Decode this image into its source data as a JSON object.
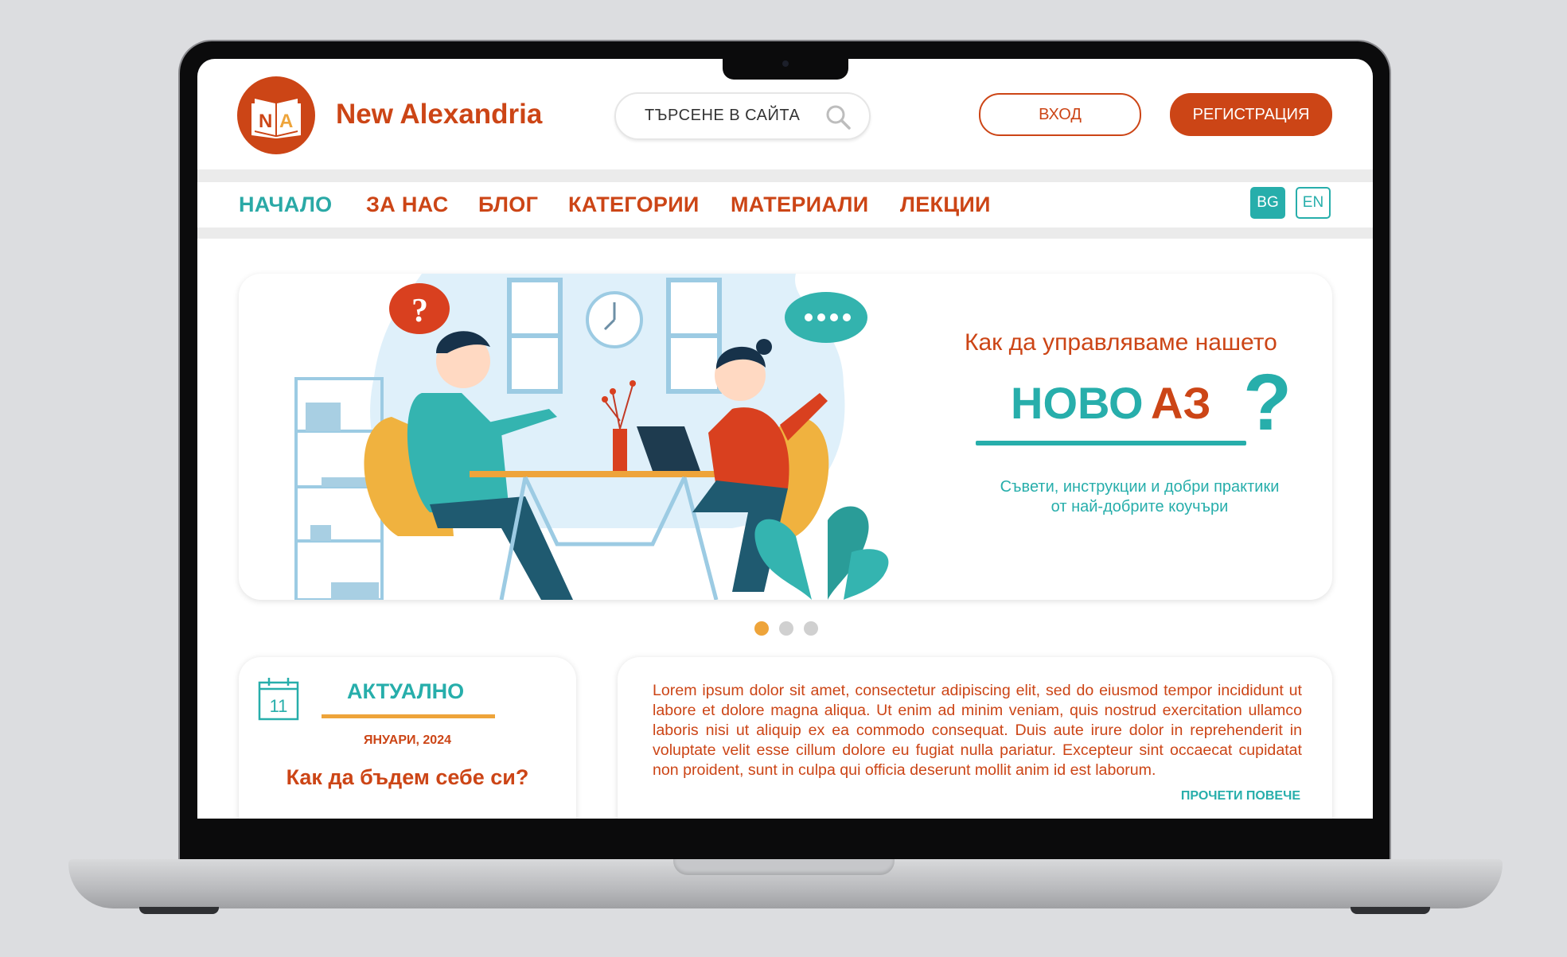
{
  "brand": {
    "logo_letters": "N|A",
    "name": "New Alexandria"
  },
  "header": {
    "search_placeholder": "ТЪРСЕНЕ В САЙТА",
    "login_label": "ВХОД",
    "register_label": "РЕГИСТРАЦИЯ"
  },
  "nav": {
    "items": [
      {
        "label": "НАЧАЛО",
        "active": true
      },
      {
        "label": "ЗА НАС"
      },
      {
        "label": "БЛОГ"
      },
      {
        "label": "КАТЕГОРИИ"
      },
      {
        "label": "МАТЕРИАЛИ"
      },
      {
        "label": "ЛЕКЦИИ"
      }
    ],
    "languages": [
      {
        "code": "BG",
        "active": true
      },
      {
        "code": "EN"
      }
    ]
  },
  "hero": {
    "subtitle": "Как да управляваме нашето",
    "title_part1": "НОВО",
    "title_part2": "АЗ",
    "title_mark": "?",
    "description_line1": "Съвети, инструкции и добри практики",
    "description_line2": "от най-добрите коучъри",
    "slides_total": 3,
    "active_slide": 1
  },
  "news_card": {
    "calendar_day": "11",
    "title": "АКТУАЛНО",
    "date": "ЯНУАРИ, 2024",
    "headline": "Как да бъдем себе си?"
  },
  "text_card": {
    "body": "Lorem ipsum dolor sit amet, consectetur adipiscing elit, sed do eiusmod tempor incididunt ut labore et dolore magna aliqua. Ut enim ad minim veniam, quis nostrud exercitation ullamco laboris nisi ut aliquip ex ea commodo consequat. Duis aute irure dolor in reprehenderit in voluptate velit esse cillum dolore eu fugiat nulla pariatur. Excepteur sint occaecat cupidatat non proident, sunt in culpa qui officia deserunt mollit anim id est laborum.",
    "read_more": "ПРОЧЕТИ ПОВЕЧЕ"
  },
  "colors": {
    "brand_orange": "#cc4516",
    "teal": "#27aeab",
    "accent_yellow": "#eea43a",
    "dot_inactive": "#d0d0d0"
  },
  "icons": [
    "search-icon",
    "calendar-icon",
    "book-logo-icon"
  ]
}
